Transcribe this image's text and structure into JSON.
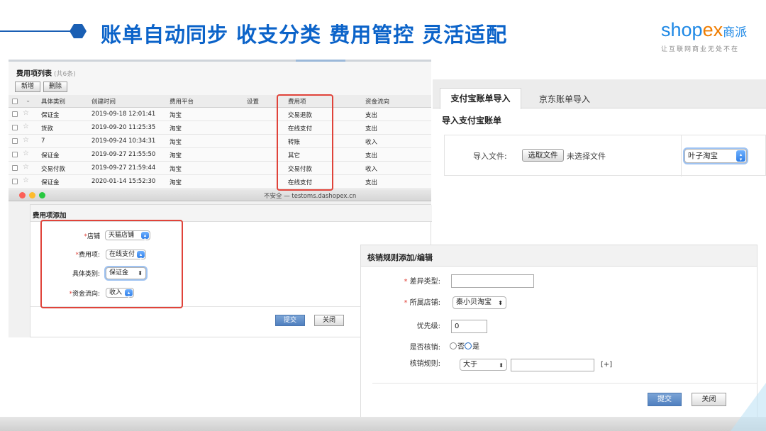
{
  "header": {
    "title": "账单自动同步 收支分类 费用管控 灵活适配",
    "logo_word_1": "shop",
    "logo_word_2": "ex",
    "logo_cn": "商派",
    "logo_slogan": "让互联网商业无处不在"
  },
  "fee_list": {
    "title": "费用项列表",
    "count": "(共6条)",
    "add_label": "新增",
    "delete_label": "删除",
    "columns": [
      "具体类别",
      "创建时间",
      "费用平台",
      "设置",
      "费用项",
      "资金流向"
    ],
    "rows": [
      {
        "category": "保证金",
        "created": "2019-09-18 12:01:41",
        "platform": "淘宝",
        "fee_item": "交易退款",
        "flow": "支出"
      },
      {
        "category": "货款",
        "created": "2019-09-20 11:25:35",
        "platform": "淘宝",
        "fee_item": "在线支付",
        "flow": "支出"
      },
      {
        "category": "7",
        "created": "2019-09-24 10:34:31",
        "platform": "淘宝",
        "fee_item": "转账",
        "flow": "收入"
      },
      {
        "category": "保证金",
        "created": "2019-09-27 21:55:50",
        "platform": "淘宝",
        "fee_item": "其它",
        "flow": "支出"
      },
      {
        "category": "交易付款",
        "created": "2019-09-27 21:59:44",
        "platform": "淘宝",
        "fee_item": "交易付款",
        "flow": "收入"
      },
      {
        "category": "保证金",
        "created": "2020-01-14 15:52:30",
        "platform": "淘宝",
        "fee_item": "在线支付",
        "flow": "支出"
      }
    ]
  },
  "fee_add_window": {
    "url": "不安全 — testoms.dashopex.cn",
    "title": "费用项添加",
    "store_label": "店铺",
    "store_value": "天猫店铺",
    "fee_item_label": "费用项:",
    "fee_item_value": "在线支付",
    "category_label": "具体类别:",
    "category_value": "保证金",
    "flow_label": "资金流向:",
    "flow_value": "收入",
    "submit_label": "提交",
    "close_label": "关闭"
  },
  "import_panel": {
    "tab_alipay": "支付宝账单导入",
    "tab_jd": "京东账单导入",
    "heading": "导入支付宝账单",
    "file_label": "导入文件:",
    "choose_file": "选取文件",
    "no_file": "未选择文件",
    "shop_value": "叶子淘宝"
  },
  "rule_panel": {
    "title": "核销规则添加/编辑",
    "diff_type_label": "差异类型:",
    "diff_type_value": "",
    "store_label": "所属店铺:",
    "store_value": "秦小贝淘宝",
    "priority_label": "优先级:",
    "priority_value": "0",
    "verify_label": "是否核销:",
    "option_no": "否",
    "option_yes": "是",
    "rule_label": "核销规则:",
    "rule_operator": "大于",
    "rule_value": "",
    "add_rule": "[+]",
    "submit_label": "提交",
    "close_label": "关闭"
  },
  "colors": {
    "title_blue": "#0b63c9",
    "highlight_red": "#e0433a",
    "logo_orange": "#f07d00"
  }
}
